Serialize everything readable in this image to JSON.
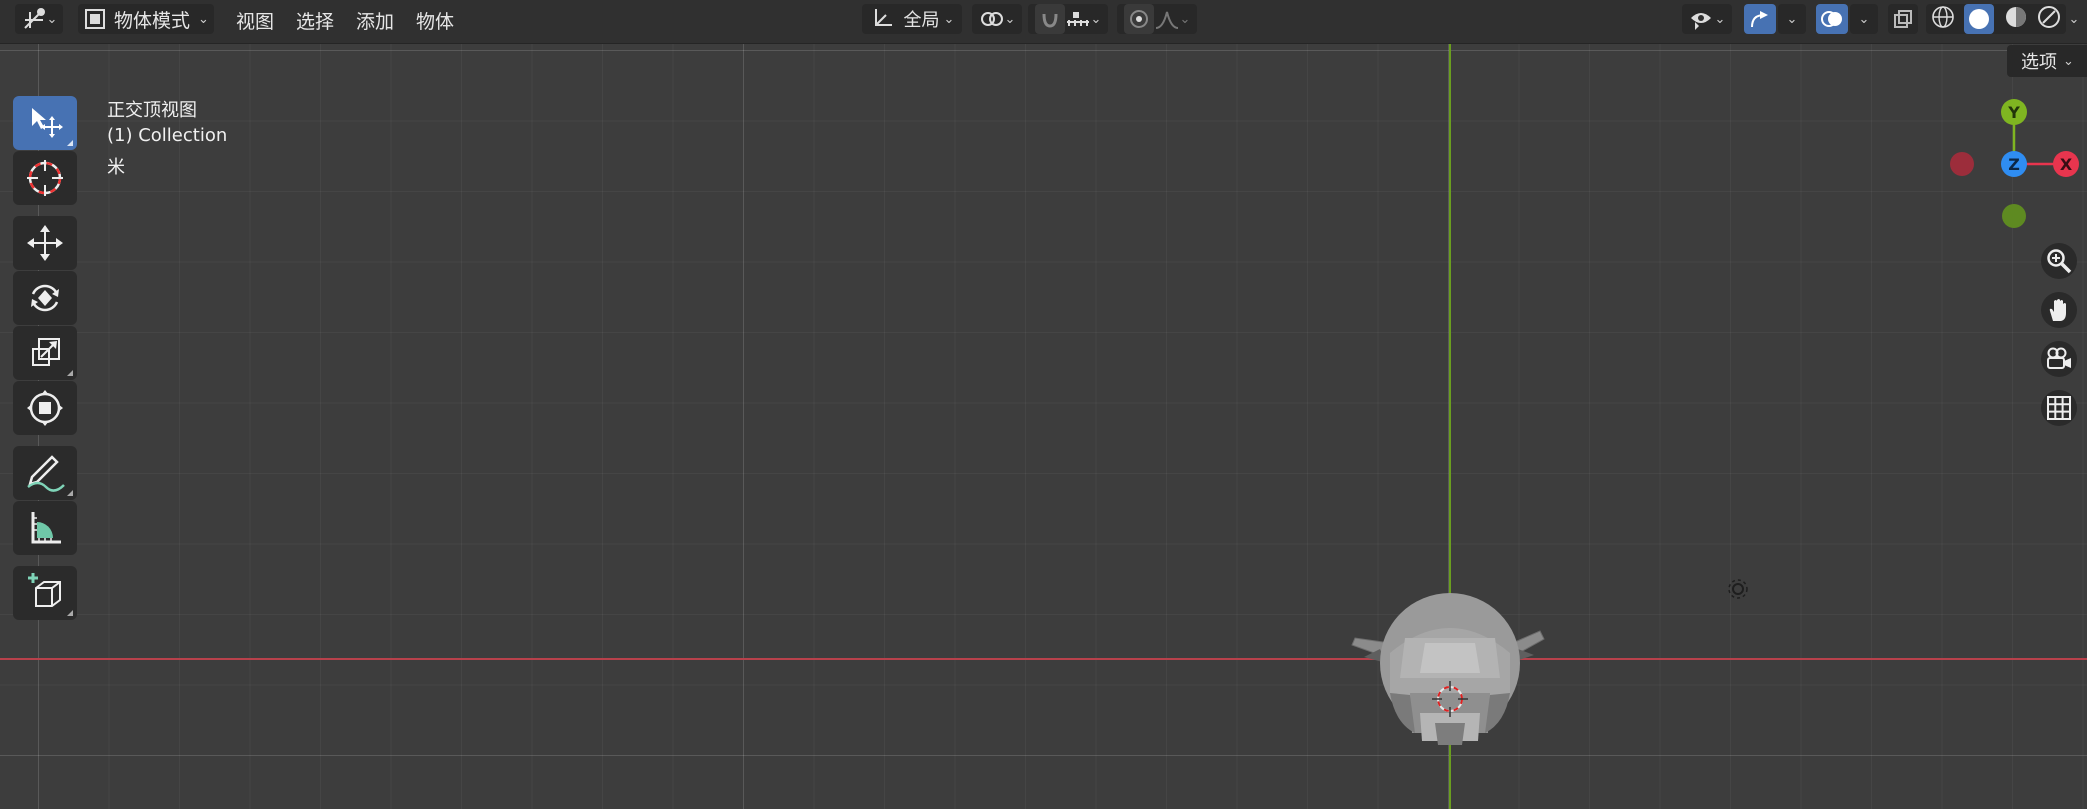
{
  "header": {
    "mode_selector": {
      "label": "物体模式"
    },
    "menus": [
      "视图",
      "选择",
      "添加",
      "物体"
    ],
    "transform_orientation": {
      "label": "全局"
    },
    "options_button": {
      "label": "选项"
    }
  },
  "viewport": {
    "view_name": "正交顶视图",
    "collection": "(1) Collection",
    "unit": "米"
  },
  "gizmo": {
    "labels": {
      "x": "X",
      "y": "Y",
      "z": "Z"
    },
    "colors": {
      "x": "#e8354e",
      "y": "#7fb521",
      "z": "#2f8df2",
      "neg_x": "#9c2d3b",
      "neg_y": "#5e8a21"
    }
  },
  "toolbar": {
    "tools": [
      "select-box",
      "cursor",
      "move",
      "rotate",
      "scale",
      "transform",
      "annotate",
      "measure",
      "add-cube"
    ],
    "active_tool": "select-box"
  },
  "colors": {
    "accent": "#4772b3",
    "x_axis": "#b8414b",
    "y_axis": "#6a9e1f"
  }
}
